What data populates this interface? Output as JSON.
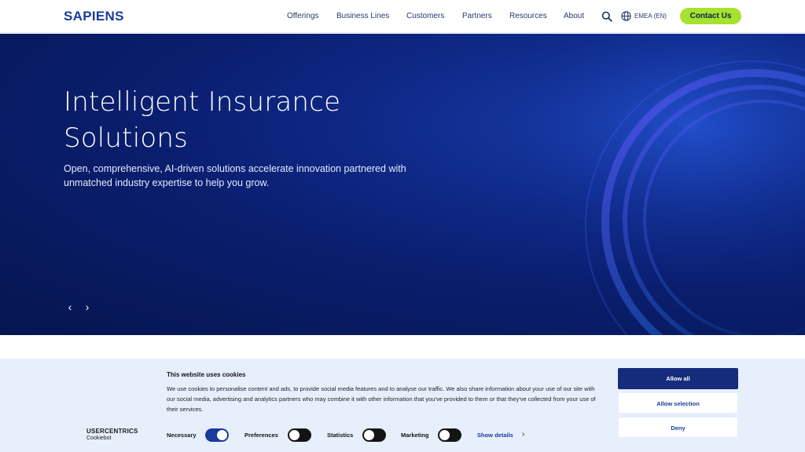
{
  "header": {
    "logo": "SAPIENS",
    "nav": [
      "Offerings",
      "Business Lines",
      "Customers",
      "Partners",
      "Resources",
      "About"
    ],
    "search_icon": "search-icon",
    "globe_icon": "globe-icon",
    "language": "EMEA (EN)",
    "contact_label": "Contact Us",
    "contact_color": "#a6e22e"
  },
  "hero": {
    "title": "Intelligent Insurance Solutions",
    "subtitle": "Open, comprehensive, AI-driven solutions accelerate innovation partnered with unmatched industry expertise to help you grow.",
    "prev_icon": "‹",
    "next_icon": "›",
    "background_color": "#0a1e6e"
  },
  "cookie": {
    "logo_line1": "USERCENTRICS",
    "logo_line2": "Cookiebot",
    "title": "This website uses cookies",
    "text": "We use cookies to personalise content and ads, to provide social media features and to analyse our traffic. We also share information about your use of our site with our social media, advertising and analytics partners who may combine it with other information that you've provided to them or that they've collected from your use of their services.",
    "toggles": [
      {
        "label": "Necessary",
        "on": true
      },
      {
        "label": "Preferences",
        "on": false
      },
      {
        "label": "Statistics",
        "on": false
      },
      {
        "label": "Marketing",
        "on": false
      }
    ],
    "show_details": "Show details",
    "chevron": "›",
    "buttons": {
      "allow_all": "Allow all",
      "allow_selection": "Allow selection",
      "deny": "Deny"
    },
    "toggle_on_color": "#1a3a9c",
    "toggle_off_color": "#141414"
  }
}
